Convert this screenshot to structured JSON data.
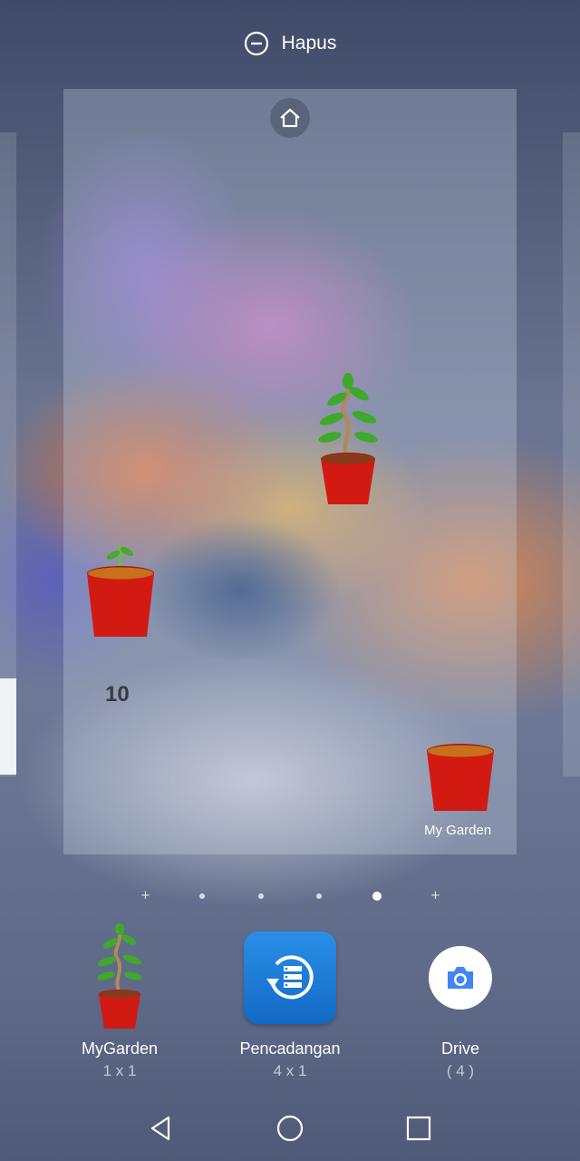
{
  "top_bar": {
    "remove_label": "Hapus",
    "icon": "minus-circle-icon"
  },
  "preview": {
    "counter": "10",
    "widget_label": "My Garden",
    "home_icon": "home-icon"
  },
  "page_indicator": {
    "pages": 4,
    "active_index": 3
  },
  "widget_tray": [
    {
      "name": "MyGarden",
      "size": "1 x 1",
      "icon": "plant-pot-icon"
    },
    {
      "name": "Pencadangan",
      "size": "4 x 1",
      "icon": "backup-icon"
    },
    {
      "name": "Drive",
      "size": "( 4 )",
      "icon": "camera-icon"
    }
  ],
  "nav": {
    "back": "back-icon",
    "home": "home-circle-icon",
    "recents": "recents-icon"
  },
  "colors": {
    "pot_red": "#d21a12",
    "backup_blue": "#1e7fdc",
    "drive_blue": "#4285f4"
  }
}
